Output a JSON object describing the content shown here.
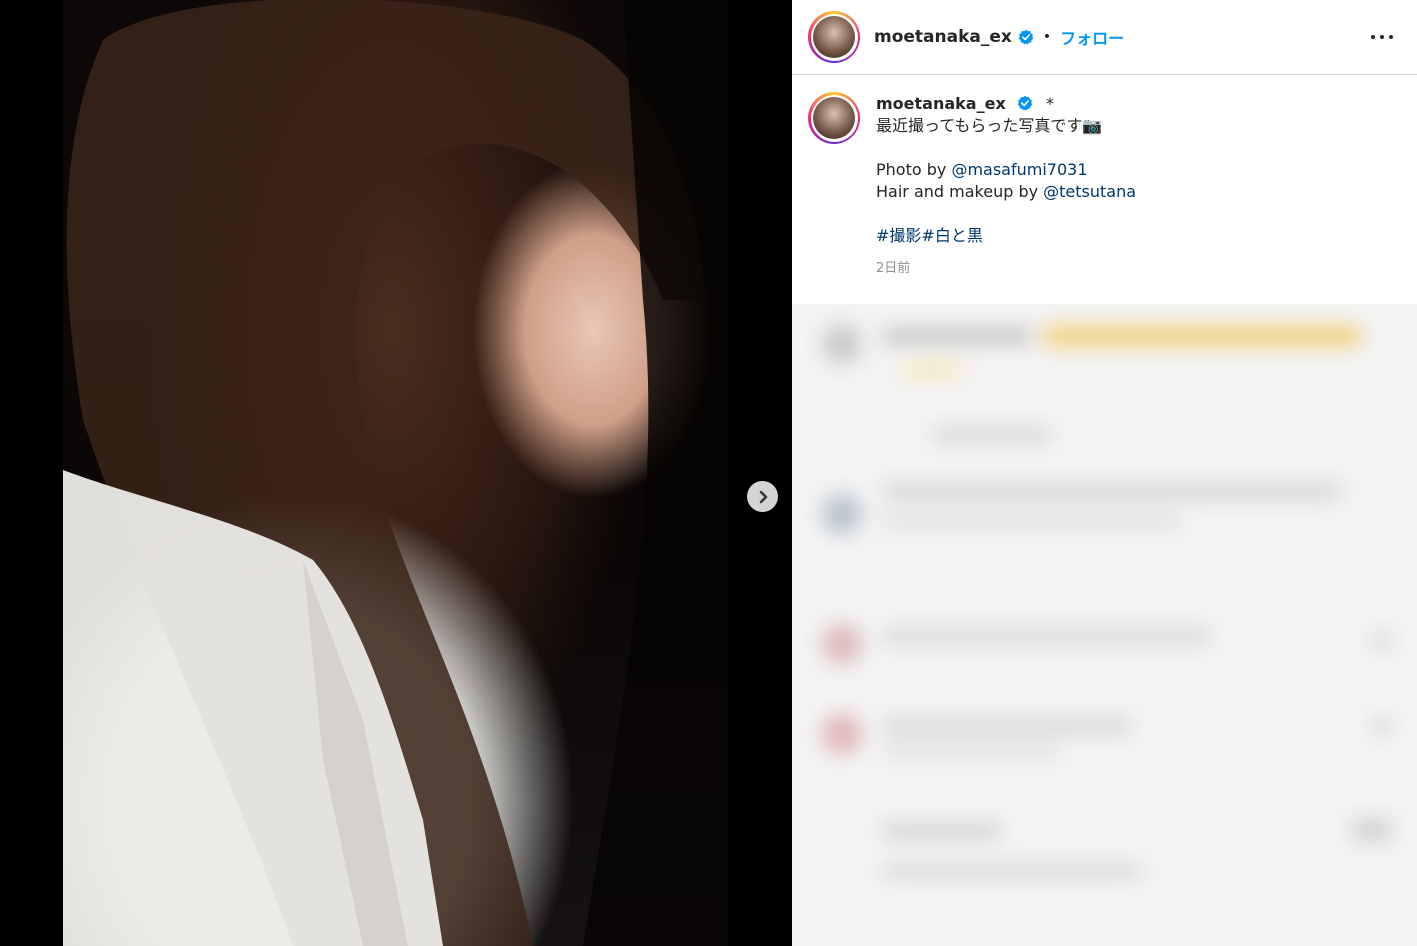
{
  "post": {
    "username": "moetanaka_ex",
    "follow_label": "フォロー",
    "separator": "•"
  },
  "caption": {
    "username": "moetanaka_ex",
    "asterisk": "*",
    "line1": "最近撮ってもらった写真です📷",
    "photo_prefix": "Photo by ",
    "photo_credit": "@masafumi7031",
    "hair_prefix": "Hair and makeup by ",
    "hair_credit": "@tetsutana",
    "hashtag1": "#撮影",
    "hashtag2": "#白と黒",
    "timestamp": "2日前"
  },
  "colors": {
    "follow": "#0095f6",
    "link": "#00376b",
    "verified": "#0095f6"
  },
  "icons": {
    "next": "chevron-right-icon",
    "more": "more-horizontal-icon",
    "verified": "verified-badge-icon"
  }
}
